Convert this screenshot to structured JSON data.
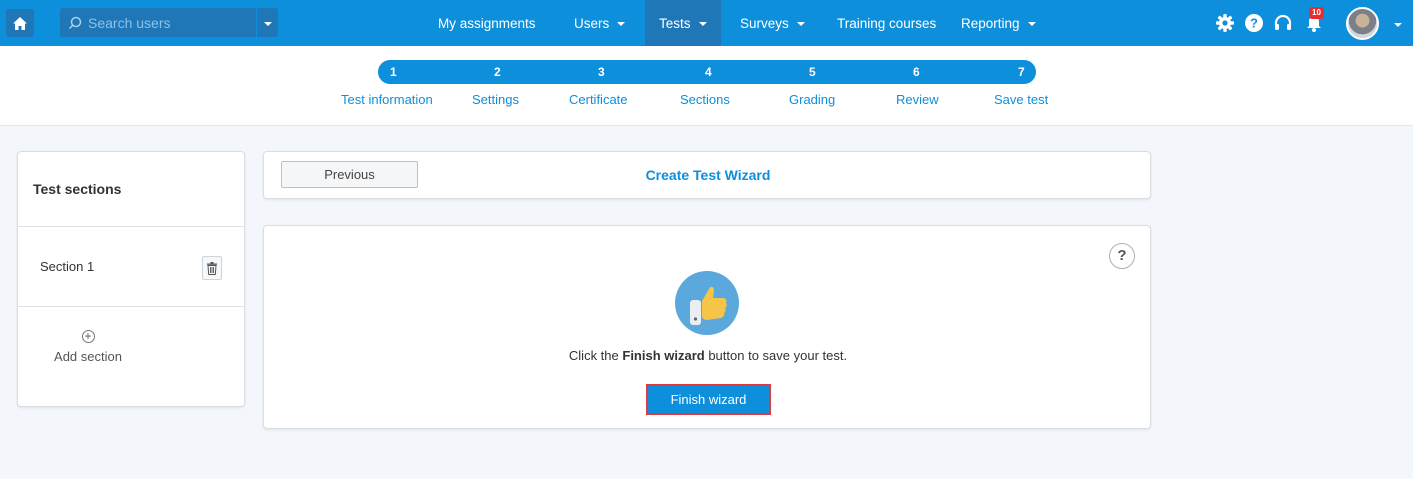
{
  "header": {
    "search": {
      "placeholder": "Search users"
    },
    "nav": [
      {
        "label": "My assignments",
        "has_caret": false,
        "active": false
      },
      {
        "label": "Users",
        "has_caret": true,
        "active": false
      },
      {
        "label": "Tests",
        "has_caret": true,
        "active": true
      },
      {
        "label": "Surveys",
        "has_caret": true,
        "active": false
      },
      {
        "label": "Training courses",
        "has_caret": false,
        "active": false
      },
      {
        "label": "Reporting",
        "has_caret": true,
        "active": false
      }
    ],
    "icons": [
      "gear-icon",
      "help-icon",
      "headset-icon",
      "bell-icon"
    ],
    "notification_count": "10",
    "colors": {
      "bar": "#0e8fdb",
      "active": "#1f77b8"
    }
  },
  "stepper": {
    "steps": [
      {
        "number": "1",
        "label": "Test information"
      },
      {
        "number": "2",
        "label": "Settings"
      },
      {
        "number": "3",
        "label": "Certificate"
      },
      {
        "number": "4",
        "label": "Sections"
      },
      {
        "number": "5",
        "label": "Grading"
      },
      {
        "number": "6",
        "label": "Review"
      },
      {
        "number": "7",
        "label": "Save test"
      }
    ]
  },
  "sidebar": {
    "title": "Test sections",
    "sections": [
      {
        "label": "Section 1"
      }
    ],
    "add_label": "Add section"
  },
  "wizard": {
    "previous_label": "Previous",
    "title": "Create Test Wizard",
    "message_prefix": "Click the ",
    "message_bold": "Finish wizard",
    "message_suffix": " button to save your test.",
    "finish_label": "Finish wizard",
    "help_label": "?"
  }
}
